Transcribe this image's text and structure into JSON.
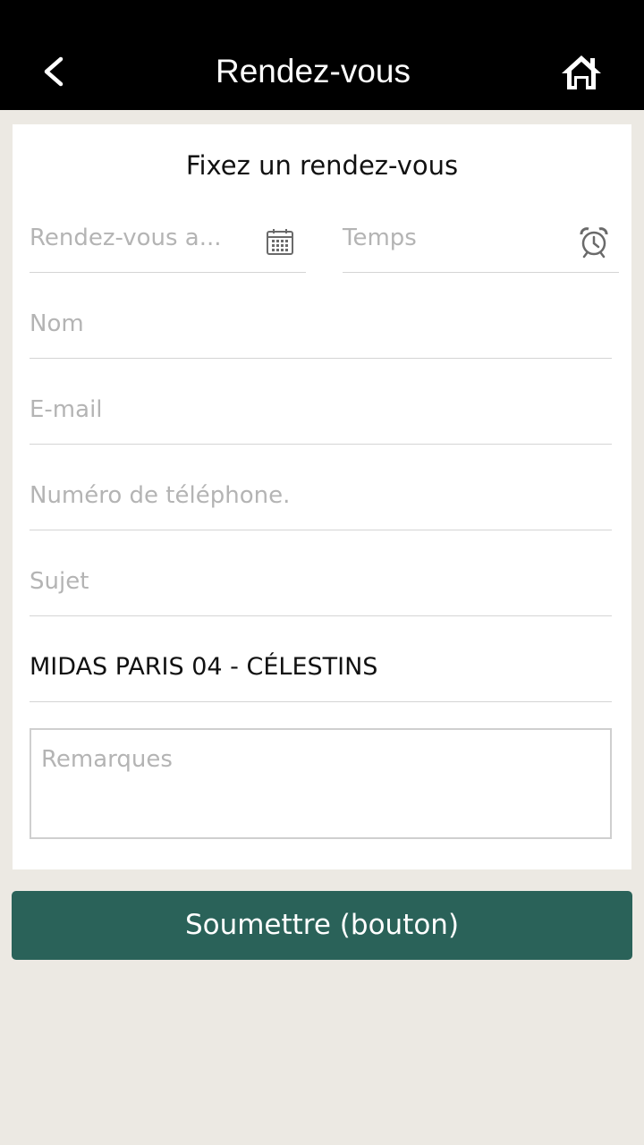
{
  "header": {
    "title": "Rendez-vous",
    "back_icon": "chevron-left-icon",
    "home_icon": "home-icon"
  },
  "form": {
    "title": "Fixez un rendez-vous",
    "date_placeholder": "Rendez-vous a...",
    "date_icon": "calendar-icon",
    "time_placeholder": "Temps",
    "time_icon": "alarm-clock-icon",
    "name_placeholder": "Nom",
    "email_placeholder": "E-mail",
    "phone_placeholder": "Numéro de téléphone.",
    "subject_placeholder": "Sujet",
    "branch_value": "MIDAS PARIS 04 - CÉLESTINS",
    "remarks_placeholder": "Remarques"
  },
  "submit_label": "Soumettre (bouton)",
  "colors": {
    "header_bg": "#000000",
    "page_bg": "#ece9e3",
    "submit_bg": "#2a6259",
    "placeholder": "#b4b4b4"
  }
}
